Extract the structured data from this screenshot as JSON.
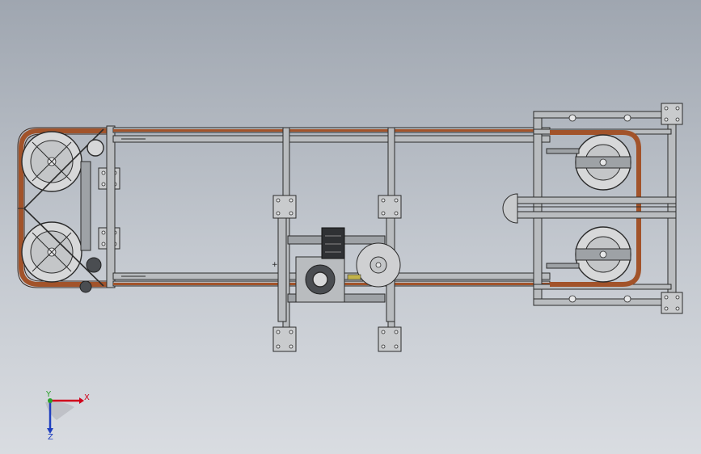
{
  "axes": {
    "x_label": "X",
    "y_label": "Y",
    "z_label": "Z",
    "x_color": "#d0021b",
    "y_color": "#2aa02a",
    "z_color": "#1f3fbf"
  },
  "colors": {
    "background_top": "#9fa6b0",
    "background_bottom": "#d9dce1",
    "belt": "#a2532a",
    "frame": "#b9bcbf"
  }
}
